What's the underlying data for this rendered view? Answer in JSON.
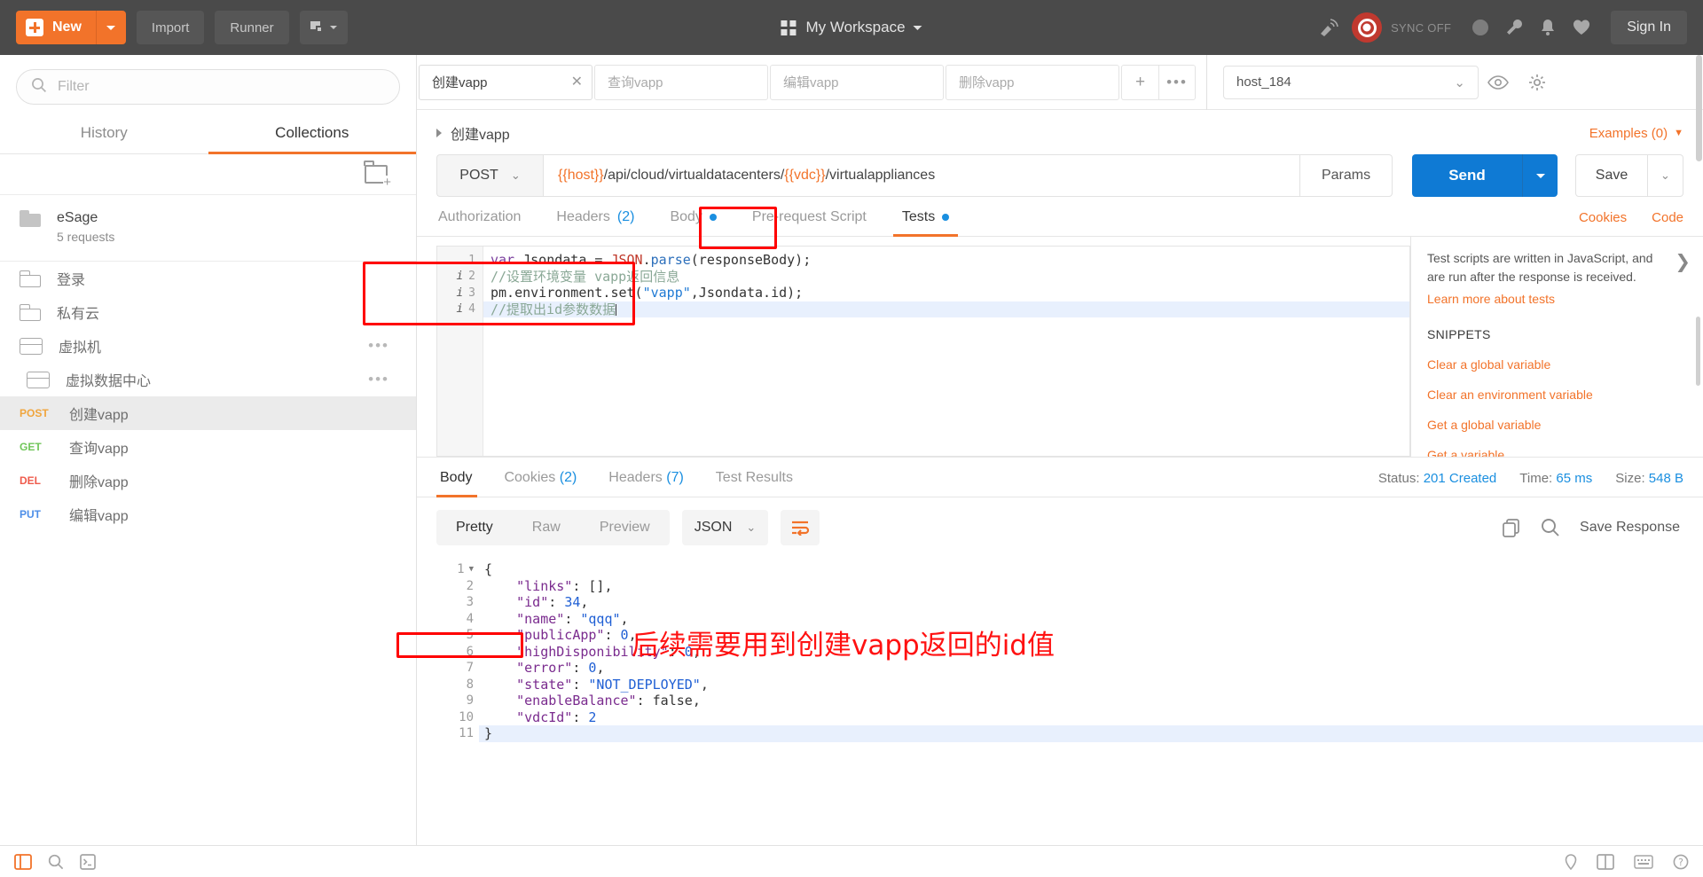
{
  "topbar": {
    "new_label": "New",
    "import_label": "Import",
    "runner_label": "Runner",
    "workspace_label": "My Workspace",
    "sync_label": "SYNC OFF",
    "signin_label": "Sign In"
  },
  "sidebar": {
    "filter_placeholder": "Filter",
    "tabs": [
      {
        "label": "History",
        "active": false
      },
      {
        "label": "Collections",
        "active": true
      }
    ],
    "collection": {
      "name": "eSage",
      "requests": "5 requests"
    },
    "folders": [
      {
        "label": "登录",
        "depth": 1,
        "open": false,
        "menu": false
      },
      {
        "label": "私有云",
        "depth": 1,
        "open": false,
        "menu": false
      },
      {
        "label": "虚拟机",
        "depth": 1,
        "open": true,
        "menu": true
      },
      {
        "label": "虚拟数据中心",
        "depth": 2,
        "open": true,
        "menu": true
      }
    ],
    "requests": [
      {
        "method": "POST",
        "name": "创建vapp",
        "selected": true
      },
      {
        "method": "GET",
        "name": "查询vapp",
        "selected": false
      },
      {
        "method": "DEL",
        "name": "删除vapp",
        "selected": false
      },
      {
        "method": "PUT",
        "name": "编辑vapp",
        "selected": false
      }
    ],
    "menu_dots": "•••"
  },
  "tabstrip": {
    "tabs": [
      {
        "label": "创建vapp",
        "active": true,
        "close": "✕"
      },
      {
        "label": "查询vapp",
        "active": false
      },
      {
        "label": "编辑vapp",
        "active": false
      },
      {
        "label": "删除vapp",
        "active": false
      }
    ],
    "add_label": "+",
    "more_label": "•••",
    "environment": "host_184"
  },
  "request": {
    "name": "创建vapp",
    "examples_label": "Examples (0)",
    "method": "POST",
    "url_prefix_var": "{{host}}",
    "url_mid": "/api/cloud/virtualdatacenters/",
    "url_vdc_var": "{{vdc}}",
    "url_suffix": "/virtualappliances",
    "params_label": "Params",
    "send_label": "Send",
    "save_label": "Save",
    "tabs": [
      {
        "label": "Authorization",
        "active": false,
        "count": null,
        "dot": false
      },
      {
        "label": "Headers",
        "active": false,
        "count": "(2)",
        "dot": false
      },
      {
        "label": "Body",
        "active": false,
        "count": null,
        "dot": true
      },
      {
        "label": "Pre-request Script",
        "active": false,
        "count": null,
        "dot": false
      },
      {
        "label": "Tests",
        "active": true,
        "count": null,
        "dot": true
      }
    ],
    "cookies_label": "Cookies",
    "code_label": "Code"
  },
  "editor": {
    "lines": [
      {
        "num": "1",
        "info": false,
        "current": false
      },
      {
        "num": "2",
        "info": true,
        "current": false
      },
      {
        "num": "3",
        "info": true,
        "current": false
      },
      {
        "num": "4",
        "info": true,
        "current": true
      }
    ],
    "line1_kw": "var",
    "line1_var": " Jsondata = ",
    "line1_cls": "JSON",
    "line1_dot": ".",
    "line1_fn": "parse",
    "line1_rest": "(responseBody);",
    "line2": "//设置环境变量 vapp返回信息",
    "line3_a": "pm.environment.set(",
    "line3_str": "\"vapp\"",
    "line3_b": ",Jsondata.id);",
    "line4": "//提取出id参数数据",
    "info_glyph": "i"
  },
  "snippets": {
    "description": "Test scripts are written in JavaScript, and are run after the response is received.",
    "learn_more": "Learn more about tests",
    "title": "SNIPPETS",
    "items": [
      "Clear a global variable",
      "Clear an environment variable",
      "Get a global variable",
      "Get a variable"
    ],
    "chevron": "❯"
  },
  "response": {
    "tabs": [
      {
        "label": "Body",
        "active": true,
        "count": null
      },
      {
        "label": "Cookies",
        "active": false,
        "count": "(2)"
      },
      {
        "label": "Headers",
        "active": false,
        "count": "(7)"
      },
      {
        "label": "Test Results",
        "active": false,
        "count": null
      }
    ],
    "status_label": "Status:",
    "status_value": "201 Created",
    "time_label": "Time:",
    "time_value": "65 ms",
    "size_label": "Size:",
    "size_value": "548 B",
    "view_modes": [
      {
        "label": "Pretty",
        "active": true
      },
      {
        "label": "Raw",
        "active": false
      },
      {
        "label": "Preview",
        "active": false
      }
    ],
    "format": "JSON",
    "save_response_label": "Save Response",
    "json_lines": [
      {
        "num": "1",
        "fold": true,
        "text": "{"
      },
      {
        "num": "2",
        "fold": false,
        "key": "\"links\"",
        "sep": ": ",
        "val": "[]",
        "val_type": "plain",
        "tail": ","
      },
      {
        "num": "3",
        "fold": false,
        "key": "\"id\"",
        "sep": ": ",
        "val": "34",
        "val_type": "num",
        "tail": ","
      },
      {
        "num": "4",
        "fold": false,
        "key": "\"name\"",
        "sep": ": ",
        "val": "\"qqq\"",
        "val_type": "str",
        "tail": ","
      },
      {
        "num": "5",
        "fold": false,
        "key": "\"publicApp\"",
        "sep": ": ",
        "val": "0",
        "val_type": "num",
        "tail": ","
      },
      {
        "num": "6",
        "fold": false,
        "key": "\"highDisponibility\"",
        "sep": ": ",
        "val": "0",
        "val_type": "num",
        "tail": ","
      },
      {
        "num": "7",
        "fold": false,
        "key": "\"error\"",
        "sep": ": ",
        "val": "0",
        "val_type": "num",
        "tail": ","
      },
      {
        "num": "8",
        "fold": false,
        "key": "\"state\"",
        "sep": ": ",
        "val": "\"NOT_DEPLOYED\"",
        "val_type": "str",
        "tail": ","
      },
      {
        "num": "9",
        "fold": false,
        "key": "\"enableBalance\"",
        "sep": ": ",
        "val": "false",
        "val_type": "plain",
        "tail": ","
      },
      {
        "num": "10",
        "fold": false,
        "key": "\"vdcId\"",
        "sep": ": ",
        "val": "2",
        "val_type": "num",
        "tail": ""
      },
      {
        "num": "11",
        "fold": false,
        "text": "}"
      }
    ]
  },
  "annotations": {
    "id_note": "后续需要用到创建vapp返回的id值",
    "color": "#ff1111"
  },
  "colors": {
    "accent_orange": "#f2732a",
    "send_blue": "#0f7ad4",
    "topbar_dark": "#4a4a4a",
    "annotation_red": "#ff0000"
  }
}
